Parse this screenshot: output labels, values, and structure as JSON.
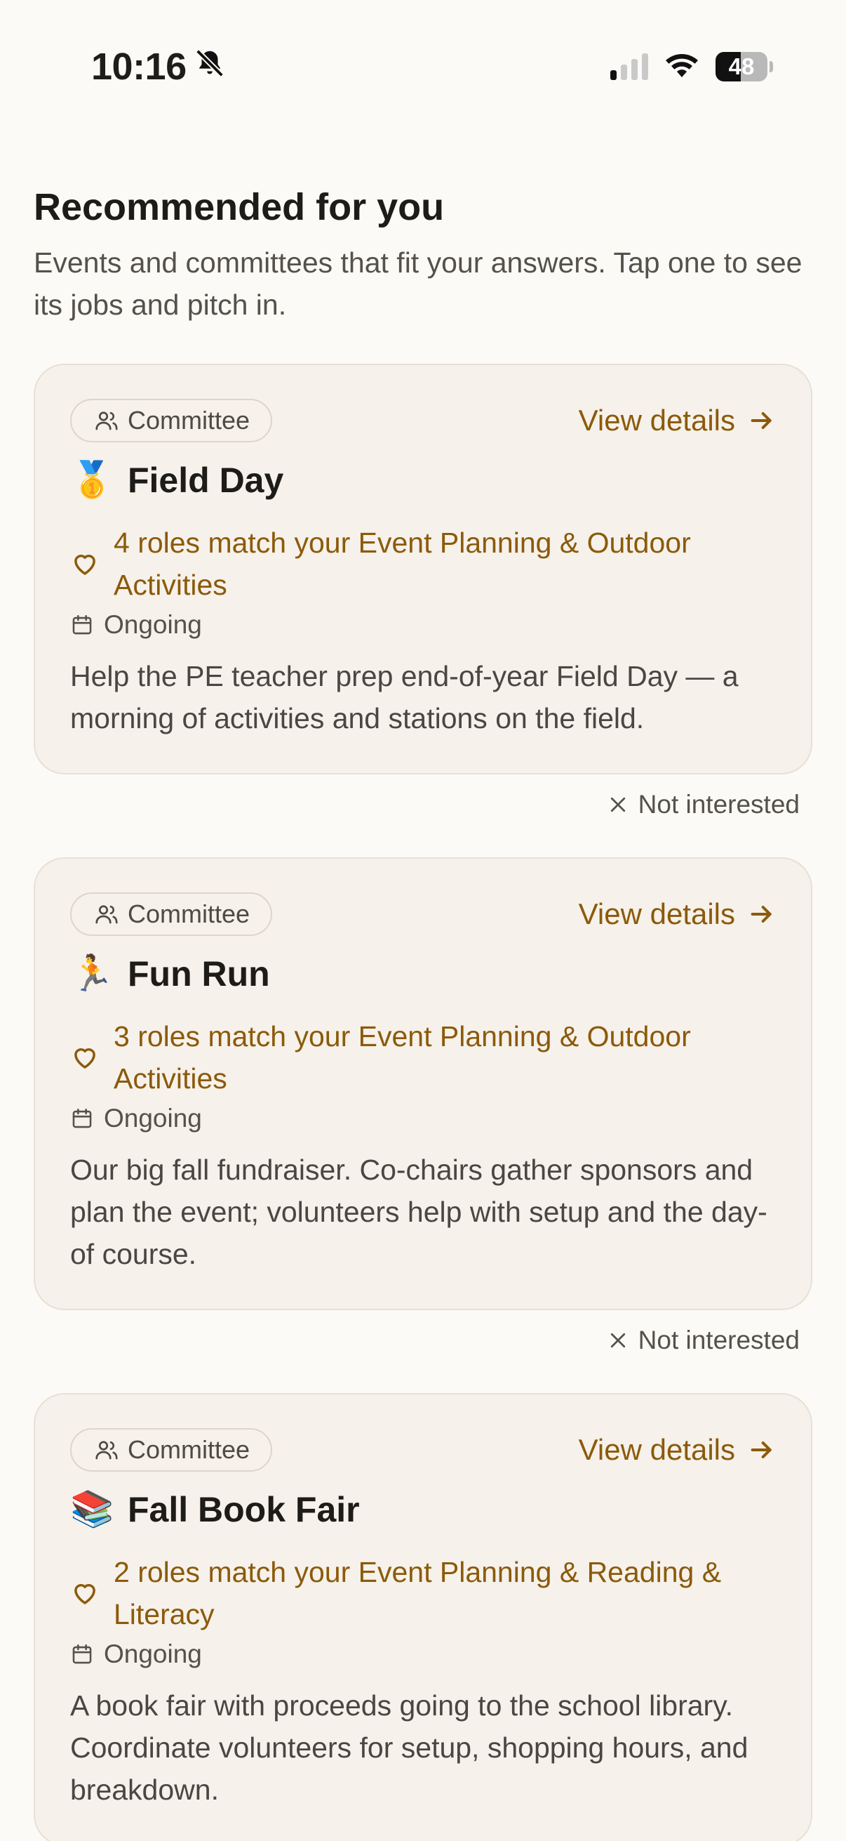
{
  "status_bar": {
    "time": "10:16",
    "battery": "48",
    "battery_level_percent": 48,
    "signal_bars_on": 1,
    "signal_bars_total": 4
  },
  "page": {
    "title": "Recommended for you",
    "subtitle": "Events and committees that fit your answers. Tap one to see its jobs and pitch in."
  },
  "cards": [
    {
      "badge": "Committee",
      "view_details": "View details",
      "emoji": "🥇",
      "title": "Field Day",
      "match": "4 roles match your Event Planning & Outdoor Activities",
      "date": "Ongoing",
      "description": "Help the PE teacher prep end-of-year Field Day — a morning of activities and stations on the field.",
      "not_interested": "Not interested"
    },
    {
      "badge": "Committee",
      "view_details": "View details",
      "emoji": "🏃",
      "title": "Fun Run",
      "match": "3 roles match your Event Planning & Outdoor Activities",
      "date": "Ongoing",
      "description": "Our big fall fundraiser. Co-chairs gather sponsors and plan the event; volunteers help with setup and the day-of course.",
      "not_interested": "Not interested"
    },
    {
      "badge": "Committee",
      "view_details": "View details",
      "emoji": "📚",
      "title": "Fall Book Fair",
      "match": "2 roles match your Event Planning & Reading & Literacy",
      "date": "Ongoing",
      "description": "A book fair with proceeds going to the school library. Coordinate volunteers for setup, shopping hours, and breakdown."
    }
  ],
  "colors": {
    "background": "#FBFAF7",
    "card": "#F6F1EA",
    "accent": "#8B5A0B",
    "text": "#1E1C19"
  }
}
